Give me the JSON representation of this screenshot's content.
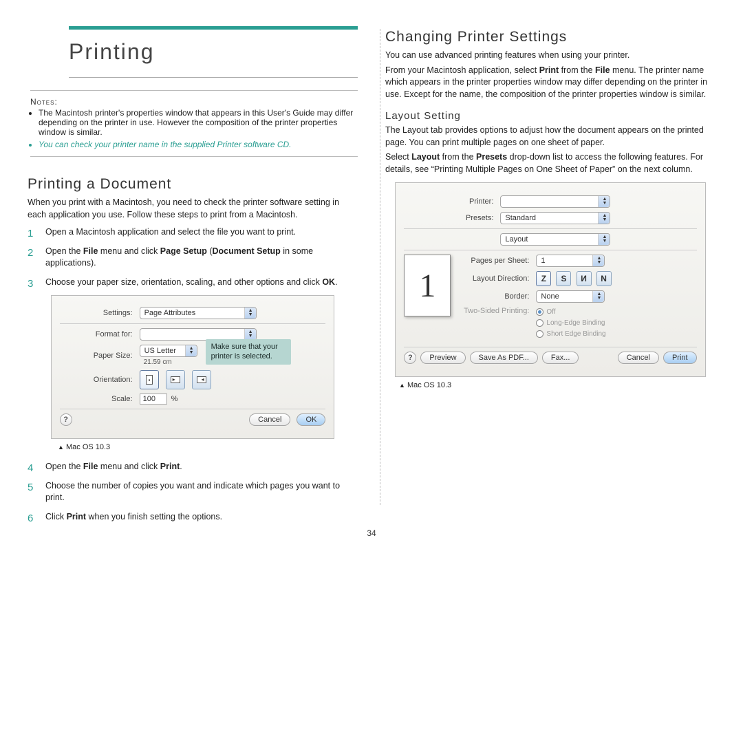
{
  "page_number": "34",
  "left": {
    "title": "Printing",
    "notes_label": "Notes:",
    "notes": [
      "The Macintosh printer's properties window that appears in this User's Guide may differ depending on the printer in use. However the composition of the printer properties window is similar.",
      "You can check your printer name in the supplied Printer software CD."
    ],
    "heading2": "Printing a Document",
    "intro": "When you print with a Macintosh, you need to check the printer software setting in each application you use. Follow these steps to print from a Macintosh.",
    "steps_a": [
      "Open a Macintosh application and select the file you want to print.",
      "Open the File menu and click Page Setup (Document Setup in some applications).",
      "Choose your paper size, orientation, scaling, and other options and click OK."
    ],
    "pagesetup": {
      "settings_label": "Settings:",
      "settings_value": "Page Attributes",
      "formatfor_label": "Format for:",
      "formatfor_value": "",
      "papersize_label": "Paper Size:",
      "papersize_value": "US Letter",
      "papersize_dim": "21.59 cm",
      "orientation_label": "Orientation:",
      "scale_label": "Scale:",
      "scale_value": "100",
      "scale_pct": "%",
      "cancel": "Cancel",
      "ok": "OK",
      "callout": "Make sure that your printer is selected."
    },
    "caption1": "Mac OS 10.3",
    "steps_b": [
      "Open the File menu and click Print.",
      "Choose the number of copies you want and indicate which pages you want to print.",
      "Click Print when you finish setting the options."
    ]
  },
  "right": {
    "heading2": "Changing Printer Settings",
    "para1": "You can use advanced printing features when using your printer.",
    "para2": "From your Macintosh application, select Print from the File menu. The printer name which appears in the printer properties window may differ depending on the printer in use. Except for the name, the composition of the printer properties window is similar.",
    "heading3": "Layout Setting",
    "para3": "The Layout tab provides options to adjust how the document appears on the printed page. You can print multiple pages on one sheet of paper.",
    "para4": "Select Layout from the Presets drop-down list to access the following features. For details, see “Printing Multiple Pages on One Sheet of Paper” on the next column.",
    "printdlg": {
      "printer_label": "Printer:",
      "printer_value": "",
      "presets_label": "Presets:",
      "presets_value": "Standard",
      "panel_value": "Layout",
      "pps_label": "Pages per Sheet:",
      "pps_value": "1",
      "dir_label": "Layout Direction:",
      "border_label": "Border:",
      "border_value": "None",
      "twosided_label": "Two-Sided Printing:",
      "two_off": "Off",
      "two_long": "Long-Edge Binding",
      "two_short": "Short Edge Binding",
      "preview_number": "1",
      "help": "?",
      "preview_btn": "Preview",
      "saveas_btn": "Save As PDF...",
      "fax_btn": "Fax...",
      "cancel": "Cancel",
      "print": "Print"
    },
    "caption2": "Mac OS 10.3"
  }
}
